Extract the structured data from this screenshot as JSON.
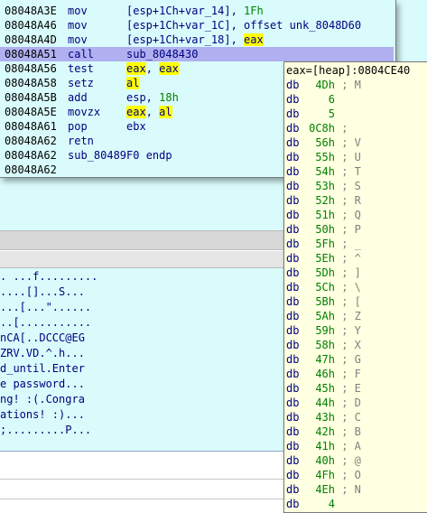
{
  "asm_view": {
    "lines": [
      {
        "addr": "08048A3E",
        "mnem": "mov",
        "ops": [
          {
            "t": "[esp+1Ch+var_14], "
          },
          {
            "t": "1Fh",
            "num": true
          }
        ]
      },
      {
        "addr": "08048A46",
        "mnem": "mov",
        "ops": [
          {
            "t": "[esp+1Ch+var_1C], offset unk_8048D60"
          }
        ]
      },
      {
        "addr": "08048A4D",
        "mnem": "mov",
        "ops": [
          {
            "t": "[esp+1Ch+var_18], "
          },
          {
            "t": "eax",
            "hl": true
          }
        ]
      },
      {
        "addr": "08048A51",
        "mnem": "call",
        "ops": [
          {
            "t": "sub_8048430"
          }
        ],
        "selected": true
      },
      {
        "addr": "08048A56",
        "mnem": "test",
        "ops": [
          {
            "t": "eax",
            "hl": true
          },
          {
            "t": ", "
          },
          {
            "t": "eax",
            "hl": true
          }
        ]
      },
      {
        "addr": "08048A58",
        "mnem": "setz",
        "ops": [
          {
            "t": "al",
            "hl": true
          }
        ]
      },
      {
        "addr": "08048A5B",
        "mnem": "add",
        "ops": [
          {
            "t": "esp, "
          },
          {
            "t": "18h",
            "num": true
          }
        ]
      },
      {
        "addr": "08048A5E",
        "mnem": "movzx",
        "ops": [
          {
            "t": "eax",
            "hl": true
          },
          {
            "t": ", "
          },
          {
            "t": "al",
            "hl": true
          }
        ]
      },
      {
        "addr": "08048A61",
        "mnem": "pop",
        "ops": [
          {
            "t": "ebx"
          }
        ]
      },
      {
        "addr": "08048A62",
        "mnem": "retn",
        "ops": []
      },
      {
        "addr": "08048A62",
        "mnem": "sub_80489F0 endp",
        "ops": []
      },
      {
        "addr": "08048A62",
        "mnem": "",
        "ops": []
      }
    ]
  },
  "hint": {
    "title": "eax=[heap]:0804CE40",
    "rows": [
      {
        "db": "db",
        "val": "4Dh",
        "cmt": "; M"
      },
      {
        "db": "db",
        "val": "6",
        "cmt": ""
      },
      {
        "db": "db",
        "val": "5",
        "cmt": ""
      },
      {
        "db": "db",
        "val": "0C8h",
        "cmt": ";"
      },
      {
        "db": "db",
        "val": "56h",
        "cmt": "; V"
      },
      {
        "db": "db",
        "val": "55h",
        "cmt": "; U"
      },
      {
        "db": "db",
        "val": "54h",
        "cmt": "; T"
      },
      {
        "db": "db",
        "val": "53h",
        "cmt": "; S"
      },
      {
        "db": "db",
        "val": "52h",
        "cmt": "; R"
      },
      {
        "db": "db",
        "val": "51h",
        "cmt": "; Q"
      },
      {
        "db": "db",
        "val": "50h",
        "cmt": "; P"
      },
      {
        "db": "db",
        "val": "5Fh",
        "cmt": "; _"
      },
      {
        "db": "db",
        "val": "5Eh",
        "cmt": "; ^"
      },
      {
        "db": "db",
        "val": "5Dh",
        "cmt": "; ]"
      },
      {
        "db": "db",
        "val": "5Ch",
        "cmt": "; \\"
      },
      {
        "db": "db",
        "val": "5Bh",
        "cmt": "; ["
      },
      {
        "db": "db",
        "val": "5Ah",
        "cmt": "; Z"
      },
      {
        "db": "db",
        "val": "59h",
        "cmt": "; Y"
      },
      {
        "db": "db",
        "val": "58h",
        "cmt": "; X"
      },
      {
        "db": "db",
        "val": "47h",
        "cmt": "; G"
      },
      {
        "db": "db",
        "val": "46h",
        "cmt": "; F"
      },
      {
        "db": "db",
        "val": "45h",
        "cmt": "; E"
      },
      {
        "db": "db",
        "val": "44h",
        "cmt": "; D"
      },
      {
        "db": "db",
        "val": "43h",
        "cmt": "; C"
      },
      {
        "db": "db",
        "val": "42h",
        "cmt": "; B"
      },
      {
        "db": "db",
        "val": "41h",
        "cmt": "; A"
      },
      {
        "db": "db",
        "val": "40h",
        "cmt": "; @"
      },
      {
        "db": "db",
        "val": "4Fh",
        "cmt": "; O"
      },
      {
        "db": "db",
        "val": "4Eh",
        "cmt": "; N"
      },
      {
        "db": "db",
        "val": "4",
        "cmt": ""
      }
    ]
  },
  "hex_view": {
    "rows": [
      ". ...f.........",
      "....[]...S...",
      "...[...\"......",
      "..[...........",
      "nCA[..DCCC@EG",
      "ZRV.VD.^.h...",
      "d_until.Enter",
      "e password...",
      "ng! :(.Congra",
      "ations! :)...",
      ";.........P..."
    ]
  },
  "colors": {
    "background": "#d9fbfb",
    "selection": "#b0b0f0",
    "highlight": "#ffff00",
    "hint_bg": "#ffffe1",
    "number": "#008000",
    "text": "#000080"
  }
}
